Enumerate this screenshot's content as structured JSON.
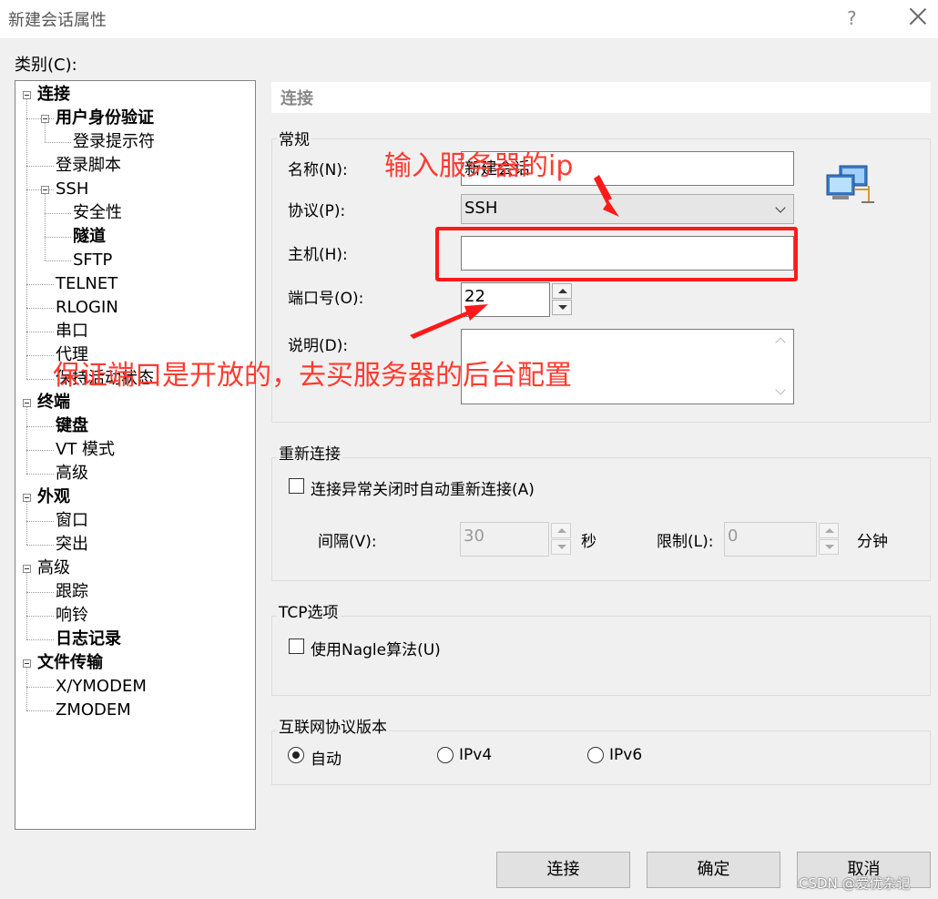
{
  "window": {
    "title": "新建会话属性",
    "help": "?"
  },
  "category_label": "类别(C):",
  "tree": [
    {
      "label": "连接",
      "level": 0,
      "bold": true
    },
    {
      "label": "用户身份验证",
      "level": 1,
      "bold": true
    },
    {
      "label": "登录提示符",
      "level": 2,
      "bold": false
    },
    {
      "label": "登录脚本",
      "level": 1,
      "bold": false
    },
    {
      "label": "SSH",
      "level": 1,
      "bold": false
    },
    {
      "label": "安全性",
      "level": 2,
      "bold": false
    },
    {
      "label": "隧道",
      "level": 2,
      "bold": true
    },
    {
      "label": "SFTP",
      "level": 2,
      "bold": false
    },
    {
      "label": "TELNET",
      "level": 1,
      "bold": false
    },
    {
      "label": "RLOGIN",
      "level": 1,
      "bold": false
    },
    {
      "label": "串口",
      "level": 1,
      "bold": false
    },
    {
      "label": "代理",
      "level": 1,
      "bold": false
    },
    {
      "label": "保持活动状态",
      "level": 1,
      "bold": false
    },
    {
      "label": "终端",
      "level": 0,
      "bold": true
    },
    {
      "label": "键盘",
      "level": 1,
      "bold": true
    },
    {
      "label": "VT 模式",
      "level": 1,
      "bold": false
    },
    {
      "label": "高级",
      "level": 1,
      "bold": false
    },
    {
      "label": "外观",
      "level": 0,
      "bold": true
    },
    {
      "label": "窗口",
      "level": 1,
      "bold": false
    },
    {
      "label": "突出",
      "level": 1,
      "bold": false
    },
    {
      "label": "高级",
      "level": 0,
      "bold": false
    },
    {
      "label": "跟踪",
      "level": 1,
      "bold": false
    },
    {
      "label": "响铃",
      "level": 1,
      "bold": false
    },
    {
      "label": "日志记录",
      "level": 1,
      "bold": true
    },
    {
      "label": "文件传输",
      "level": 0,
      "bold": true
    },
    {
      "label": "X/YMODEM",
      "level": 1,
      "bold": false
    },
    {
      "label": "ZMODEM",
      "level": 1,
      "bold": false
    }
  ],
  "section_title": "连接",
  "general": {
    "group_label": "常规",
    "name_label": "名称(N):",
    "name_value": "新建会话",
    "protocol_label": "协议(P):",
    "protocol_value": "SSH",
    "host_label": "主机(H):",
    "host_value": "",
    "port_label": "端口号(O):",
    "port_value": "22",
    "desc_label": "说明(D):",
    "desc_value": ""
  },
  "reconnect": {
    "group_label": "重新连接",
    "checkbox_label": "连接异常关闭时自动重新连接(A)",
    "interval_label": "间隔(V):",
    "interval_value": "30",
    "interval_unit": "秒",
    "limit_label": "限制(L):",
    "limit_value": "0",
    "limit_unit": "分钟"
  },
  "tcp": {
    "group_label": "TCP选项",
    "nagle_label": "使用Nagle算法(U)"
  },
  "ipver": {
    "group_label": "互联网协议版本",
    "options": [
      "自动",
      "IPv4",
      "IPv6"
    ],
    "selected": "自动"
  },
  "buttons": {
    "connect": "连接",
    "ok": "确定",
    "cancel": "取消"
  },
  "annotations": {
    "host_hint": "输入服务器的ip",
    "port_hint": "保证端口是开放的，去买服务器的后台配置"
  },
  "watermark": "CSDN @爱优杂记",
  "colors": {
    "annotation": "#ff1a1a"
  }
}
